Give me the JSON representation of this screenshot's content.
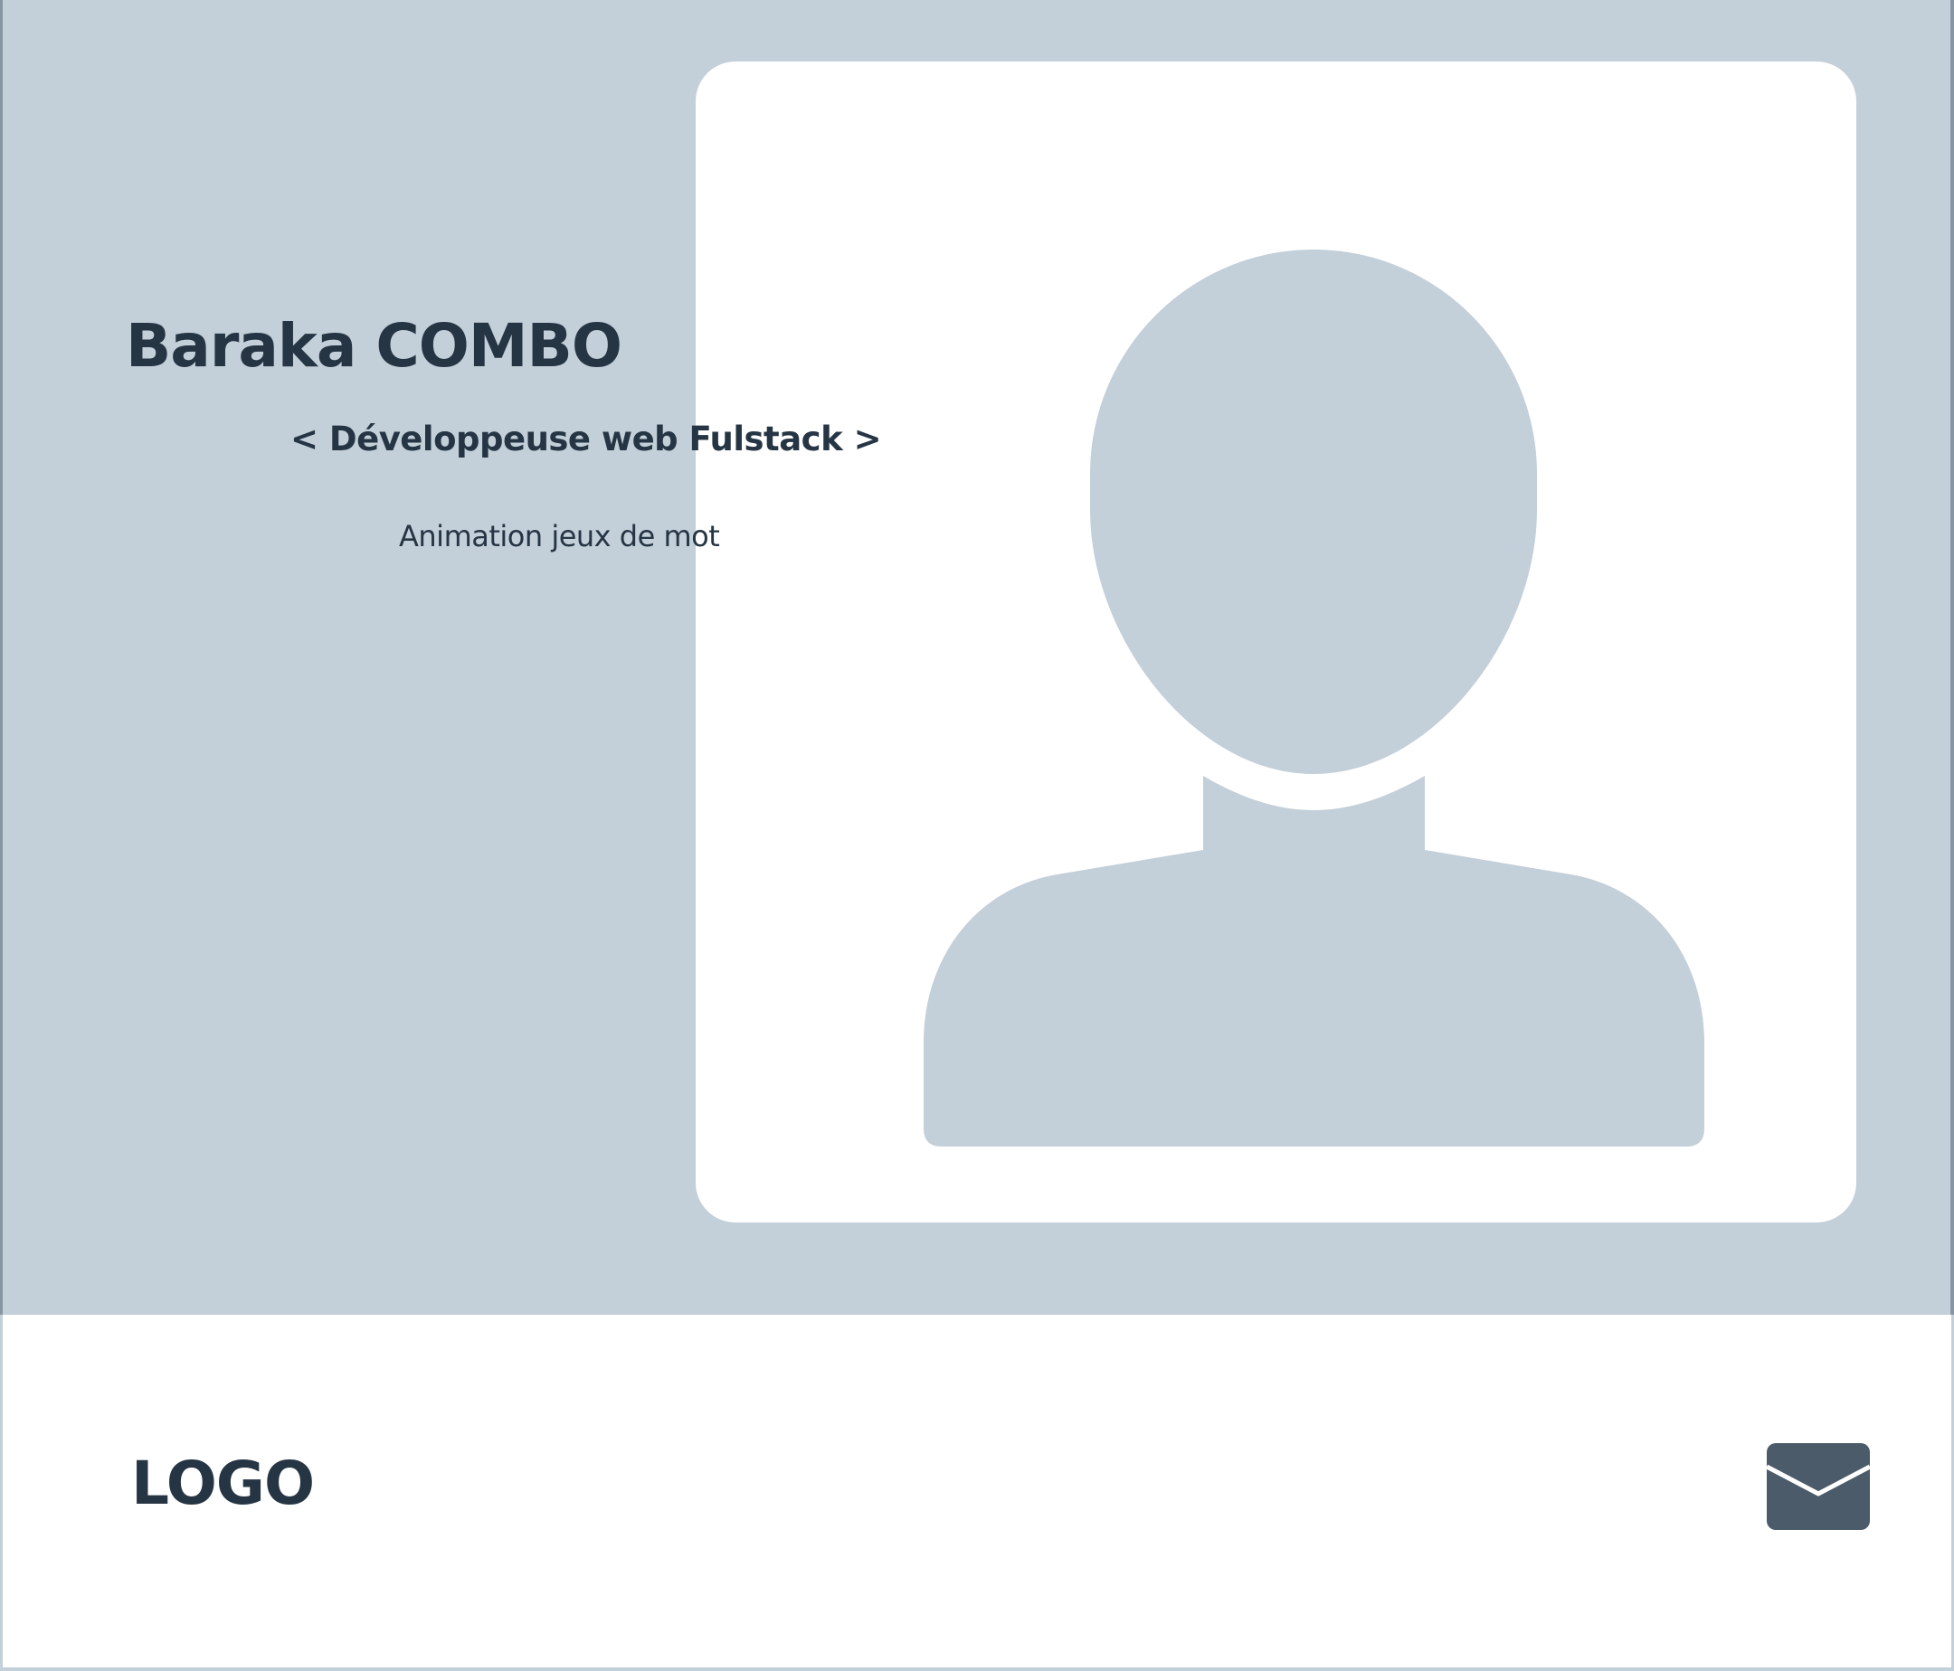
{
  "hero": {
    "name": "Baraka COMBO",
    "role": "< Développeuse web Fulstack >",
    "tagline": "Animation jeux de mot",
    "photo_placeholder_icon": "user-silhouette-icon"
  },
  "footer": {
    "logo": "LOGO",
    "contact_icon": "envelope-icon"
  },
  "colors": {
    "hero_background": "#c3cfd9",
    "card_background": "#ffffff",
    "silhouette": "#c3cfd9",
    "text": "#263544",
    "icon": "#4b5b69"
  }
}
